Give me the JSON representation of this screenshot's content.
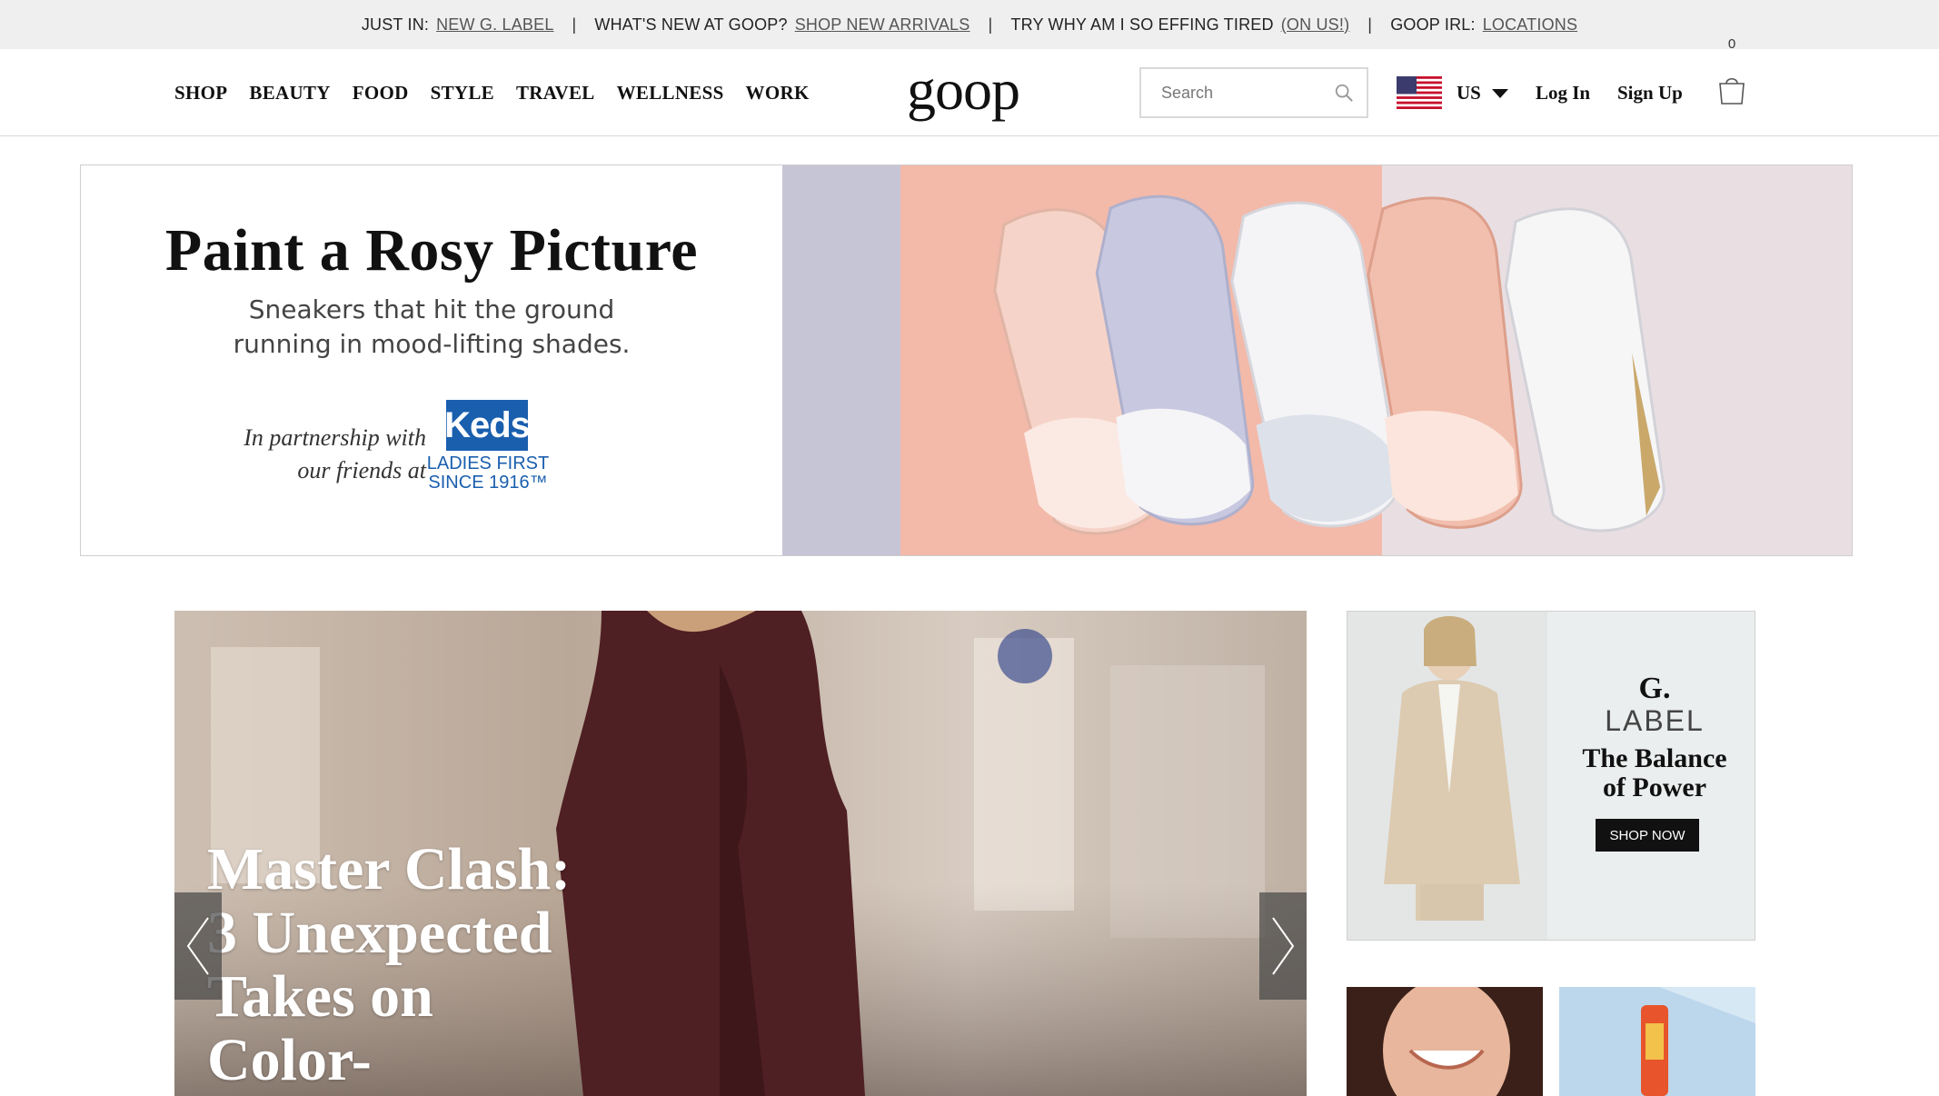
{
  "announcement": {
    "items": [
      {
        "lead": "JUST IN:",
        "link": "NEW G. LABEL"
      },
      {
        "lead": "WHAT'S NEW AT GOOP?",
        "link": "SHOP NEW ARRIVALS"
      },
      {
        "lead": "TRY WHY AM I SO EFFING TIRED",
        "link": "(ON US!)"
      },
      {
        "lead": "GOOP IRL:",
        "link": "LOCATIONS"
      }
    ],
    "separator": "|"
  },
  "header": {
    "nav": [
      "SHOP",
      "BEAUTY",
      "FOOD",
      "STYLE",
      "TRAVEL",
      "WELLNESS",
      "WORK"
    ],
    "logo": "goop",
    "search_placeholder": "Search",
    "country": "US",
    "login": "Log In",
    "signup": "Sign Up",
    "cart_count": "0"
  },
  "banner": {
    "title": "Paint a Rosy Picture",
    "subtitle_line1": "Sneakers that hit the ground",
    "subtitle_line2": "running in mood-lifting shades.",
    "partner_line1": "In partnership with",
    "partner_line2": "our friends at",
    "brand": "Keds",
    "brand_tag_line1": "LADIES FIRST",
    "brand_tag_line2": "SINCE 1916™"
  },
  "hero": {
    "title_lines": [
      "Master Clash:",
      "3 Unexpected",
      "Takes on",
      "Color-"
    ]
  },
  "promo": {
    "g": "G.",
    "label": "LABEL",
    "title_line1": "The Balance",
    "title_line2": "of Power",
    "button": "SHOP NOW"
  },
  "colors": {
    "topbar_bg": "#efefef",
    "keds_blue": "#1a5fae",
    "banner_pink": "#f2b8a8",
    "banner_lilac": "#c4c4d4"
  }
}
